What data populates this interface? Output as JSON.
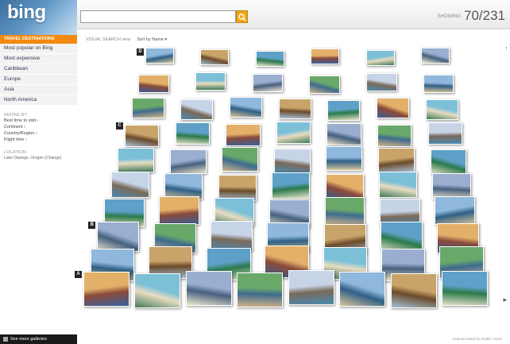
{
  "header": {
    "logo": "bing",
    "search_placeholder": "",
    "counter_label": "SHOWING",
    "counter": "70/231"
  },
  "sidebar": {
    "selected": "TRAVEL DESTINATIONS",
    "items": [
      "Most popular on Bing",
      "Most expensive",
      "Caribbean",
      "Europe",
      "Asia",
      "North America"
    ],
    "refine_heading": "REFINE BY",
    "filters": [
      "Best time to visit ›",
      "Continent ›",
      "Country/Region ›",
      "Flight time ›"
    ],
    "location_heading": "LOCATION",
    "location_text": "Lake Oswego, Oregon (Change)",
    "see_more": "See more galleries"
  },
  "toolbar": {
    "view": "VISUAL SEARCH view",
    "sort": "Sort by Name ▾"
  },
  "rows": [
    {
      "marker": "D",
      "count": 6
    },
    {
      "marker": "",
      "count": 6
    },
    {
      "marker": "",
      "count": 7
    },
    {
      "marker": "C",
      "count": 7
    },
    {
      "marker": "",
      "count": 7
    },
    {
      "marker": "",
      "count": 7
    },
    {
      "marker": "",
      "count": 7
    },
    {
      "marker": "B",
      "count": 7
    },
    {
      "marker": "",
      "count": 7
    },
    {
      "marker": "A",
      "count": 8
    }
  ],
  "footer": "Data provided by Visible Vision",
  "scroll_marks": {
    "top": "↑",
    "bottom": "▸"
  },
  "colors": {
    "accent": "#f28a11",
    "search_button": "#f0a81b"
  }
}
